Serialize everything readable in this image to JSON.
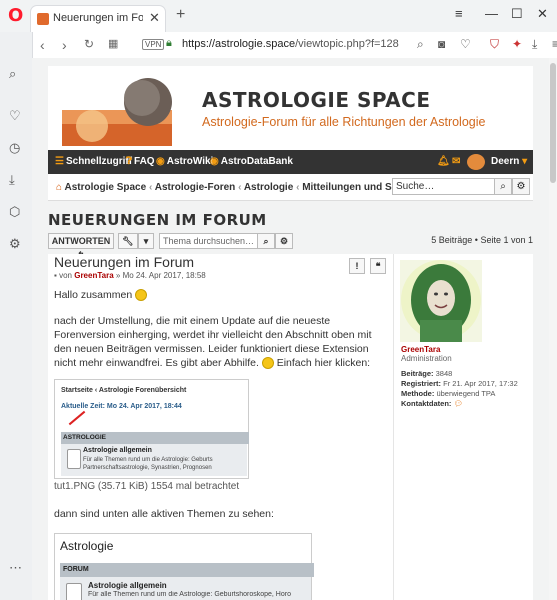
{
  "browser": {
    "tab_title": "Neuerungen im Forum - Ast",
    "url_host": "https://astrologie.space",
    "url_path": "/viewtopic.php?f=128",
    "vpn_label": "VPN"
  },
  "site": {
    "title": "ASTROLOGIE SPACE",
    "description": "Astrologie-Forum für alle Richtungen der Astrologie"
  },
  "navbar": {
    "items": [
      "Schnellzugriff",
      "FAQ",
      "AstroWiki",
      "AstroDataBank"
    ],
    "user": "Deern"
  },
  "breadcrumb": {
    "items": [
      "Astrologie Space",
      "Astrologie-Foren",
      "Astrologie",
      "Mitteilungen und Support"
    ]
  },
  "search": {
    "placeholder": "Suche…",
    "topic_placeholder": "Thema durchsuchen…"
  },
  "topic": {
    "title": "NEUERUNGEN IM FORUM",
    "reply_label": "ANTWORTEN",
    "pagination": "5 Beiträge • Seite 1 von 1"
  },
  "post": {
    "title": "Neuerungen im Forum",
    "meta_prefix": "von",
    "author": "GreenTara",
    "date": "» Mo 24. Apr 2017, 18:58",
    "greeting": "Hallo zusammen",
    "paragraph": "nach der Umstellung, die mit einem Update auf die neueste Forenversion einherging, werdet ihr vielleicht den Abschnitt oben mit den neuen Beiträgen vermissen. Leider funktioniert diese Extension nicht mehr einwandfrei. Es gibt aber Abhilfe.",
    "paragraph_end": "Einfach hier klicken:",
    "attachment_caption": "tut1.PNG (35.71 KiB) 1554 mal betrachtet",
    "line2": "dann sind unten alle aktiven Themen zu sehen:",
    "shot1": {
      "crumb": "Startseite ‹ Astrologie Forenübersicht",
      "time": "Aktuelle Zeit: Mo 24. Apr 2017, 18:44",
      "bar": "ASTROLOGIE",
      "forum_name": "Astrologie allgemein",
      "forum_desc1": "Für alle Themen rund um die Astrologie: Geburts",
      "forum_desc2": "Partnerschaftsastrologie, Synastrien, Prognosen"
    },
    "shot2": {
      "heading": "Astrologie",
      "bar": "FORUM",
      "forum_name": "Astrologie allgemein",
      "forum_desc": "Für alle Themen rund um die Astrologie: Geburtshoroskope, Horo"
    }
  },
  "profile": {
    "username": "GreenTara",
    "rank": "Administration",
    "posts_label": "Beiträge:",
    "posts_value": "3848",
    "registered_label": "Registriert:",
    "registered_value": "Fr 21. Apr 2017, 17:32",
    "method_label": "Methode:",
    "method_value": "überwiegend TPA",
    "contact_label": "Kontaktdaten:"
  },
  "colors": {
    "accent": "#d2691e",
    "navbar": "#333333",
    "username": "#aa0000"
  }
}
